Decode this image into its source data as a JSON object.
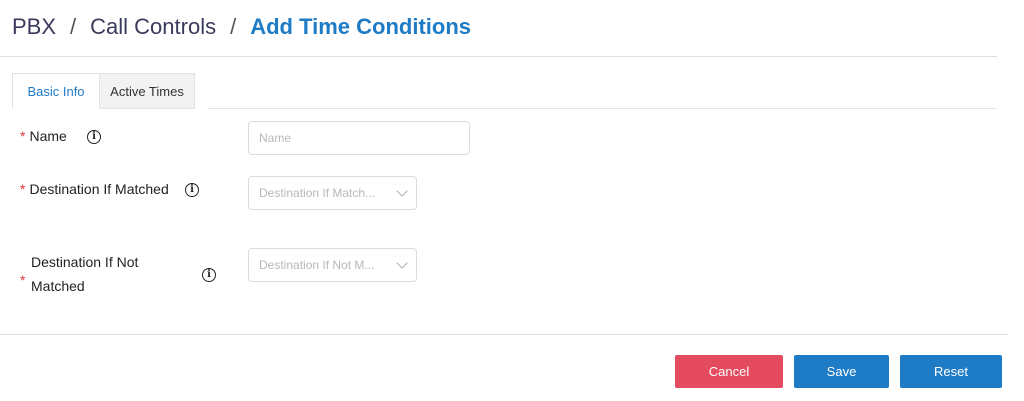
{
  "breadcrumb": {
    "items": [
      "PBX",
      "Call Controls"
    ],
    "separator": "/",
    "current": "Add Time Conditions"
  },
  "tabs": [
    {
      "label": "Basic Info",
      "active": true
    },
    {
      "label": "Active Times",
      "active": false
    }
  ],
  "form": {
    "required_mark": "*",
    "name": {
      "label": "Name",
      "placeholder": "Name"
    },
    "destination_matched": {
      "label": "Destination If Matched",
      "placeholder": "Destination If Match..."
    },
    "destination_not_matched": {
      "label_line1": "Destination If Not",
      "label_line2": "Matched",
      "placeholder": "Destination If Not M..."
    }
  },
  "info_icon": "i",
  "buttons": {
    "cancel": "Cancel",
    "save": "Save",
    "reset": "Reset"
  },
  "colors": {
    "accent": "#1e7bc6",
    "danger": "#e54b5e",
    "required": "#e0303a"
  }
}
